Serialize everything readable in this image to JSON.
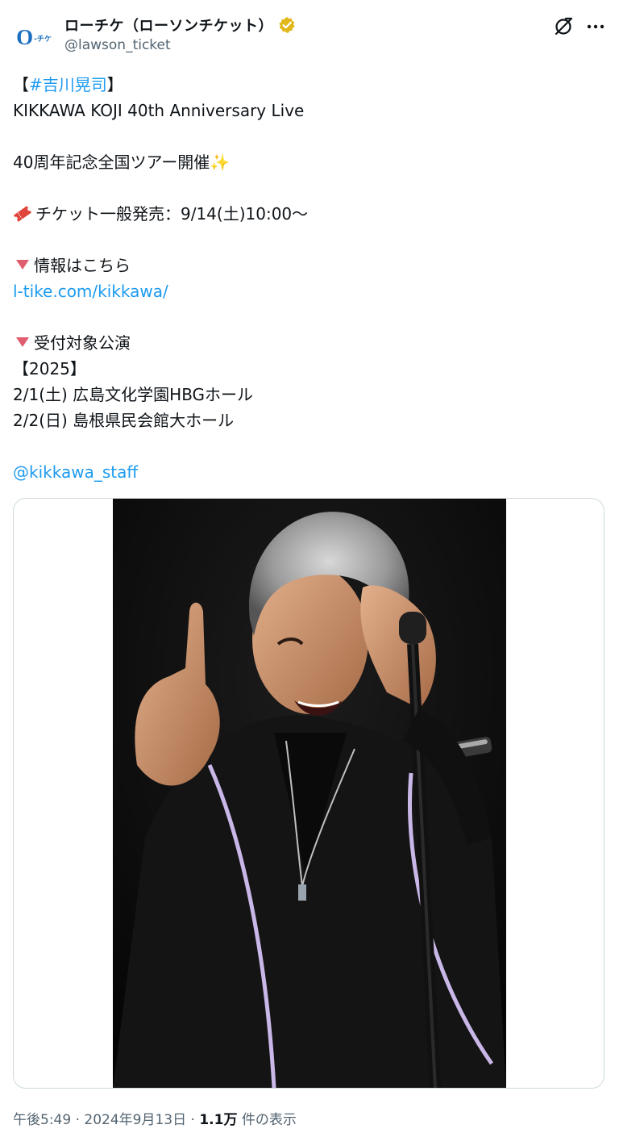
{
  "author": {
    "display_name": "ローチケ（ローソンチケット）",
    "handle": "@lawson_ticket",
    "avatar_text": "O-チケ",
    "verified": true,
    "verified_color": "#e2b719"
  },
  "icons": {
    "grok": "grok-icon",
    "more": "more-icon",
    "ticket": "ticket-emoji",
    "sparkles": "sparkles-emoji",
    "down_triangle": "red-down-triangle"
  },
  "post": {
    "hashtag_open": "【",
    "hashtag": "#吉川晃司",
    "hashtag_close": "】",
    "line_title": "KIKKAWA KOJI 40th Anniversary Live",
    "line_tour": "40周年記念全国ツアー開催",
    "sparkles": "✨",
    "line_ticket": "チケット一般発売：9/14(土)10:00～",
    "line_info": "情報はこちら",
    "link": "l-tike.com/kikkawa/",
    "line_target": "受付対象公演",
    "year": "【2025】",
    "show1": "2/1(土) 広島文化学園HBGホール",
    "show2": "2/2(日) 島根県民会館大ホール",
    "mention": "@kikkawa_staff"
  },
  "meta": {
    "time": "午後5:49",
    "sep1": " · ",
    "date": "2024年9月13日",
    "sep2": " · ",
    "views_count": "1.1万",
    "views_label": " 件の表示"
  },
  "colors": {
    "link": "#1d9bf0",
    "secondary_text": "#536471",
    "border": "#cfd9de"
  }
}
